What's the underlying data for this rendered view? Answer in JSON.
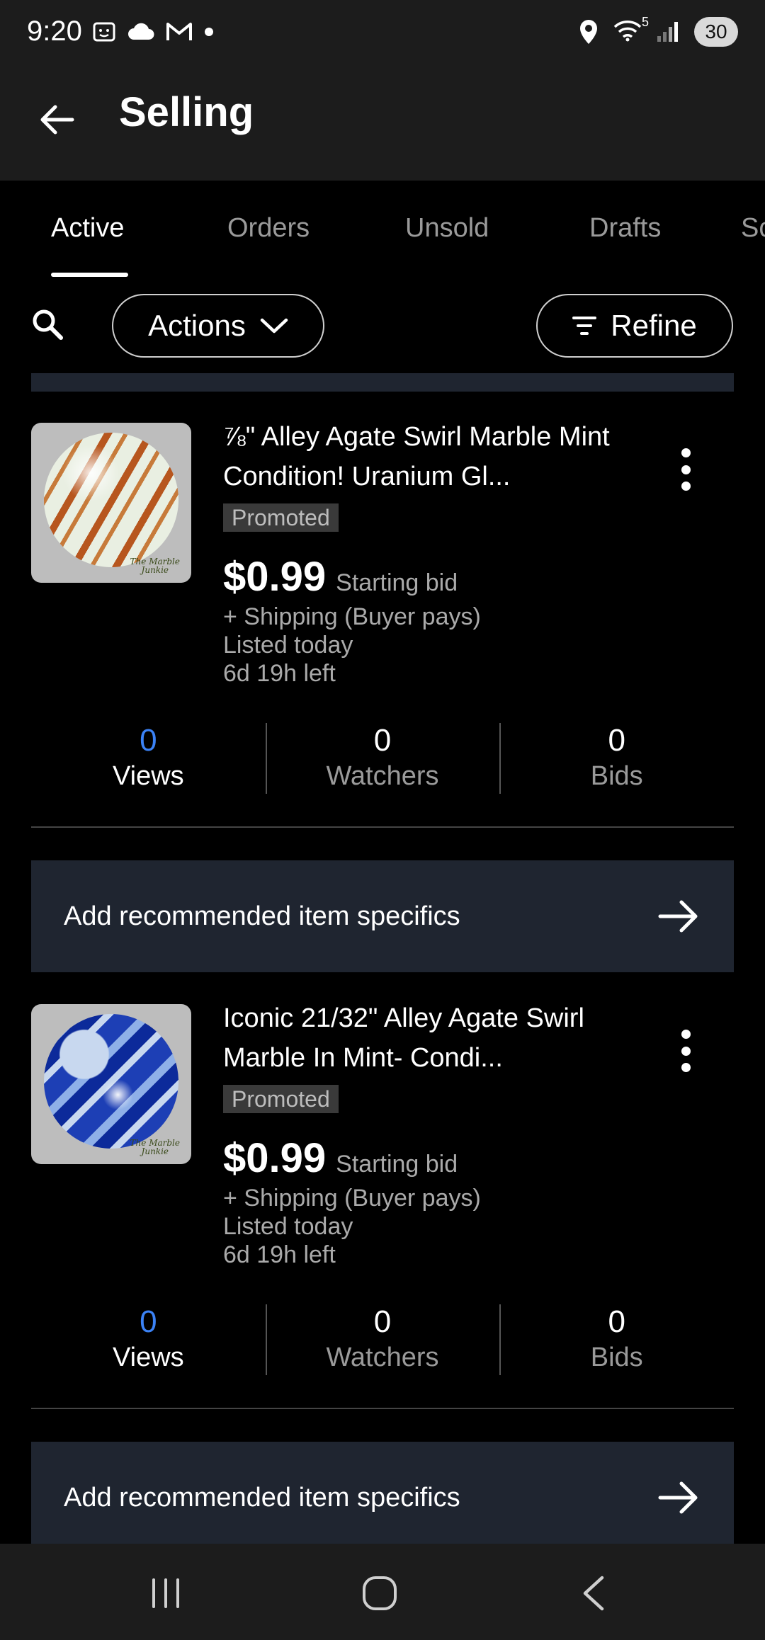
{
  "status_bar": {
    "time": "9:20",
    "battery": "30",
    "signal_label": "5",
    "icons_left": [
      "screenshot-icon",
      "cloud-icon",
      "gmail-icon",
      "dot-icon"
    ],
    "icons_right": [
      "location-icon",
      "wifi-icon",
      "signal-icon",
      "battery-icon"
    ]
  },
  "header": {
    "title": "Selling"
  },
  "tabs": [
    {
      "label": "Active",
      "active": true
    },
    {
      "label": "Orders",
      "active": false
    },
    {
      "label": "Unsold",
      "active": false
    },
    {
      "label": "Drafts",
      "active": false
    },
    {
      "label": "Sc",
      "active": false
    }
  ],
  "toolbar": {
    "actions_label": "Actions",
    "refine_label": "Refine"
  },
  "listings": [
    {
      "title": "⅞\" Alley Agate Swirl Marble Mint Condition! Uranium Gl...",
      "badge": "Promoted",
      "price": "$0.99",
      "bid_type": "Starting bid",
      "shipping": "+ Shipping (Buyer pays)",
      "listed": "Listed today",
      "time_left": "6d 19h left",
      "thumb_mark_1": "The Marble",
      "thumb_mark_2": "Junkie",
      "stats": {
        "views": "0",
        "views_label": "Views",
        "watchers": "0",
        "watchers_label": "Watchers",
        "bids": "0",
        "bids_label": "Bids"
      },
      "recommendation": "Add recommended item specifics"
    },
    {
      "title": "Iconic 21/32\" Alley Agate Swirl Marble In Mint- Condi...",
      "badge": "Promoted",
      "price": "$0.99",
      "bid_type": "Starting bid",
      "shipping": "+ Shipping (Buyer pays)",
      "listed": "Listed today",
      "time_left": "6d 19h left",
      "thumb_mark_1": "The Marble",
      "thumb_mark_2": "Junkie",
      "stats": {
        "views": "0",
        "views_label": "Views",
        "watchers": "0",
        "watchers_label": "Watchers",
        "bids": "0",
        "bids_label": "Bids"
      },
      "recommendation": "Add recommended item specifics"
    }
  ],
  "colors": {
    "background": "#000000",
    "surface": "#1c1c1c",
    "banner": "#1f2530",
    "accent_blue": "#3b82f6",
    "muted_text": "#aaaaaa"
  }
}
